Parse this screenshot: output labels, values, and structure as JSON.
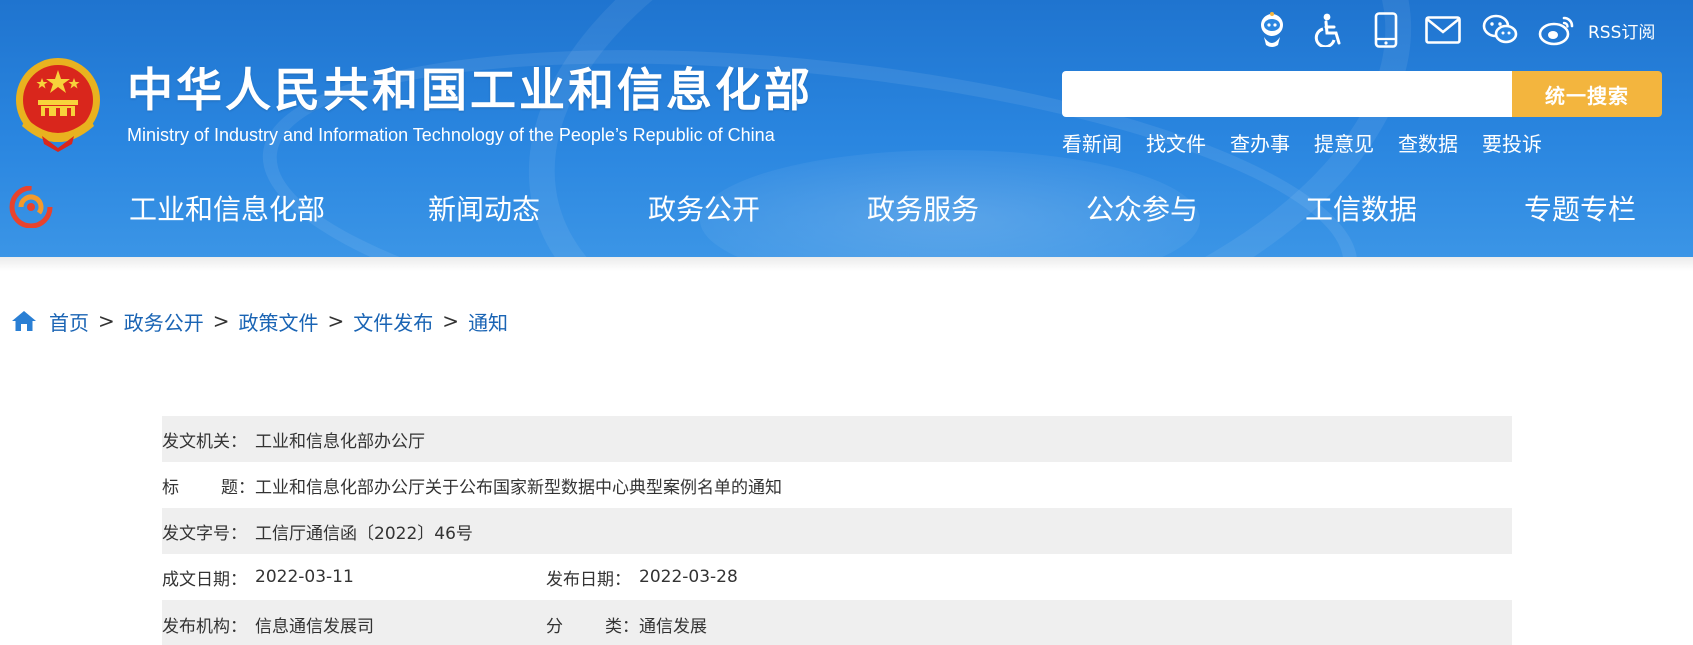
{
  "header": {
    "title": "中华人民共和国工业和信息化部",
    "subtitle": "Ministry of Industry and Information Technology of the People’s Republic of China",
    "top_icons": [
      "robot-assistant-icon",
      "accessibility-icon",
      "mobile-icon",
      "mail-icon",
      "wechat-icon",
      "weibo-icon"
    ],
    "rss_label": "RSS订阅",
    "search": {
      "value": "",
      "placeholder": "",
      "button_label": "统一搜索"
    },
    "quick_links": [
      "看新闻",
      "找文件",
      "查办事",
      "提意见",
      "查数据",
      "要投诉"
    ],
    "nav": [
      "工业和信息化部",
      "新闻动态",
      "政务公开",
      "政务服务",
      "公众参与",
      "工信数据",
      "专题专栏"
    ]
  },
  "breadcrumb": [
    "首页",
    "政务公开",
    "政策文件",
    "文件发布",
    "通知"
  ],
  "breadcrumb_separator": ">",
  "info": {
    "issuer_label": "发文机关：",
    "issuer_value": "工业和信息化部办公厅",
    "title_label_a": "标",
    "title_label_b": "题：",
    "title_value": "工业和信息化部办公厅关于公布国家新型数据中心典型案例名单的通知",
    "doc_no_label": "发文字号：",
    "doc_no_value": "工信厅通信函〔2022〕46号",
    "written_date_label": "成文日期：",
    "written_date_value": "2022-03-11",
    "publish_date_label": "发布日期：",
    "publish_date_value": "2022-03-28",
    "publisher_label": "发布机构：",
    "publisher_value": "信息通信发展司",
    "category_label_a": "分",
    "category_label_b": "类：",
    "category_value": "通信发展"
  },
  "colors": {
    "header_blue": "#2a86e0",
    "search_button": "#f3b53e",
    "breadcrumb_link": "#1a64b4",
    "row_shade": "#efefef"
  }
}
